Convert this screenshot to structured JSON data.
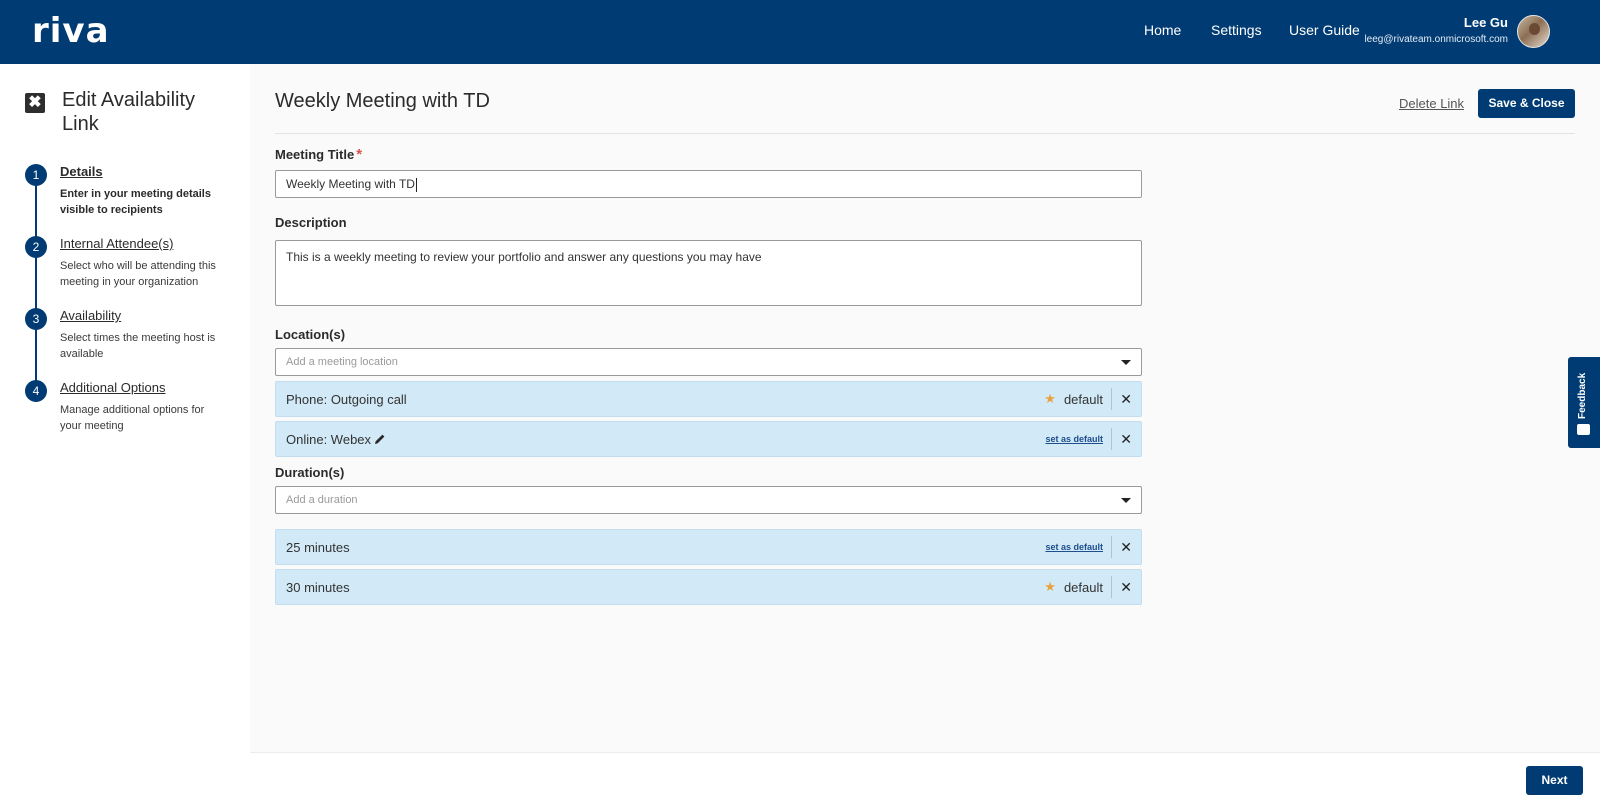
{
  "header": {
    "logo": "riva",
    "nav": [
      {
        "label": "Home"
      },
      {
        "label": "Settings"
      },
      {
        "label": "User Guide"
      }
    ],
    "user": {
      "name": "Lee Gu",
      "email": "leeg@rivateam.onmicrosoft.com"
    }
  },
  "sidebar": {
    "close_icon": "✖",
    "title": "Edit Availability Link",
    "steps": [
      {
        "number": "1",
        "title": "Details",
        "description": "Enter in your meeting details visible to recipients",
        "active": true
      },
      {
        "number": "2",
        "title": "Internal Attendee(s)",
        "description": "Select who will be attending this meeting in your organization"
      },
      {
        "number": "3",
        "title": "Availability",
        "description": "Select times the meeting host is available"
      },
      {
        "number": "4",
        "title": "Additional Options",
        "description": "Manage additional options for your meeting"
      }
    ]
  },
  "main": {
    "title": "Weekly Meeting with TD",
    "delete_label": "Delete Link",
    "save_label": "Save & Close",
    "meeting_title": {
      "label": "Meeting Title",
      "required_mark": "*",
      "value": "Weekly Meeting with TD"
    },
    "description": {
      "label": "Description",
      "value": "This is a weekly meeting to review your portfolio and answer any questions you may have"
    },
    "locations": {
      "label": "Location(s)",
      "placeholder": "Add a meeting location",
      "items": [
        {
          "label": "Phone: Outgoing call",
          "is_default": true,
          "default_text": "default"
        },
        {
          "label": "Online: Webex",
          "is_default": false,
          "set_default_text": "set as default",
          "editable": true
        }
      ]
    },
    "durations": {
      "label": "Duration(s)",
      "placeholder": "Add a duration",
      "items": [
        {
          "label": "25 minutes",
          "is_default": false,
          "set_default_text": "set as default"
        },
        {
          "label": "30 minutes",
          "is_default": true,
          "default_text": "default"
        }
      ]
    }
  },
  "footer": {
    "next_label": "Next"
  },
  "feedback": {
    "label": "Feedback"
  },
  "icons": {
    "star": "★",
    "remove": "✕",
    "pencil": "pencil-icon"
  },
  "colors": {
    "primary": "#003b73",
    "chip_bg": "#d2e9f7",
    "star": "#e9a23b",
    "required": "#d9534f"
  }
}
